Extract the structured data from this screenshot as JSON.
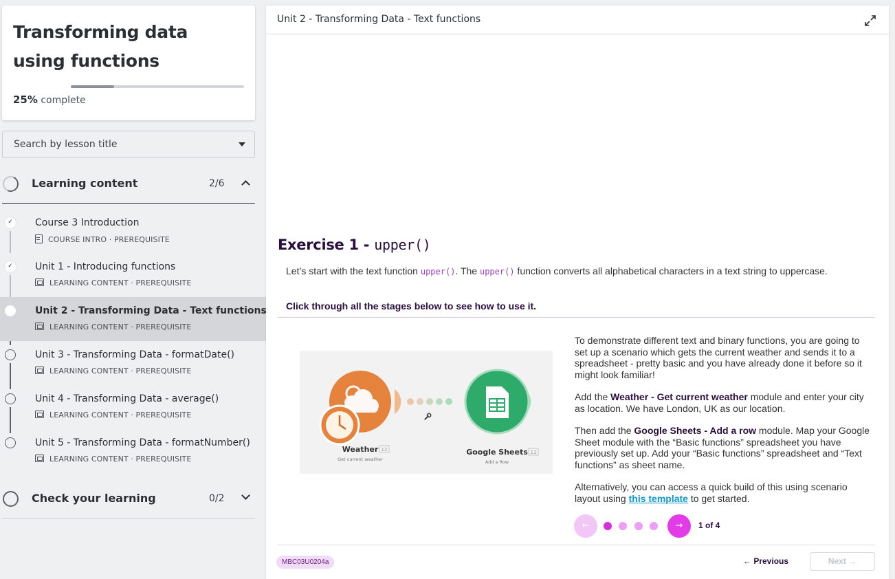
{
  "course": {
    "title": "Transforming data using functions",
    "progress_percent": 25,
    "progress_pct_label": "25%",
    "progress_suffix": "complete"
  },
  "search": {
    "label": "Search by lesson title"
  },
  "sections": [
    {
      "title": "Learning content",
      "count": "2/6",
      "expanded": true
    },
    {
      "title": "Check your learning",
      "count": "0/2",
      "expanded": false
    }
  ],
  "lessons": [
    {
      "title": "Course 3 Introduction",
      "meta": "COURSE INTRO · PREREQUISITE",
      "status": "done",
      "icon": "document-icon"
    },
    {
      "title": "Unit 1 - Introducing functions",
      "meta": "LEARNING CONTENT · PREREQUISITE",
      "status": "done",
      "icon": "slides-icon"
    },
    {
      "title": "Unit 2 - Transforming Data - Text functions",
      "meta": "LEARNING CONTENT · PREREQUISITE",
      "status": "current",
      "icon": "slides-icon"
    },
    {
      "title": "Unit 3 - Transforming Data - formatDate()",
      "meta": "LEARNING CONTENT · PREREQUISITE",
      "status": "todo",
      "icon": "slides-icon"
    },
    {
      "title": "Unit 4 - Transforming Data - average()",
      "meta": "LEARNING CONTENT · PREREQUISITE",
      "status": "todo",
      "icon": "slides-icon"
    },
    {
      "title": "Unit 5 - Transforming Data - formatNumber()",
      "meta": "LEARNING CONTENT · PREREQUISITE",
      "status": "todo",
      "icon": "slides-icon"
    }
  ],
  "main": {
    "header_title": "Unit 2 - Transforming Data - Text functions",
    "exercise": {
      "title_prefix": "Exercise 1 - ",
      "title_code": "upper()",
      "intro_1": "Let’s start with the text function ",
      "intro_code_1": "upper()",
      "intro_2": ". The ",
      "intro_code_2": "upper()",
      "intro_3": " function converts all alphabetical characters in a text string to uppercase.",
      "instruction": "Click through all the stages below to see how to use it."
    },
    "scenario": {
      "module1_name": "Weather",
      "module1_badge": "12",
      "module1_action": "Get current weather",
      "module2_name": "Google Sheets",
      "module2_badge": "11",
      "module2_action": "Add a Row"
    },
    "body": {
      "p1": "To demonstrate different text and binary functions, you are going to set up a scenario which gets the current weather and sends it to a spreadsheet - pretty basic and you have already done it before so it might look familiar!",
      "p2_a": "Add the ",
      "p2_b": "Weather - Get current weather",
      "p2_c": " module and enter your city as location. We have London, UK as our location.",
      "p3_a": "Then add the ",
      "p3_b": "Google Sheets - Add a row",
      "p3_c": " module. Map your Google Sheet module with the “Basic functions” spreadsheet you have previously set up. Add your “Basic functions” spreadsheet and “Text functions” as sheet name.",
      "p4_a": "Alternatively, you can access a quick build of this using scenario layout using ",
      "p4_link": "this template",
      "p4_c": " to get started."
    },
    "pager": {
      "prev": "←",
      "next": "→",
      "current": 1,
      "total": 4,
      "count_label": "1 of 4"
    },
    "footer": {
      "code": "MBC03U0204a",
      "prev_label": "← Previous",
      "next_label": "Next →"
    }
  },
  "colors": {
    "accent": "#e13ce8",
    "accent_light": "#f2c6f5",
    "heading": "#2a0e3d",
    "link": "#1199cf",
    "weather_orange": "#e5823c",
    "sheets_green": "#2eaa6a"
  }
}
